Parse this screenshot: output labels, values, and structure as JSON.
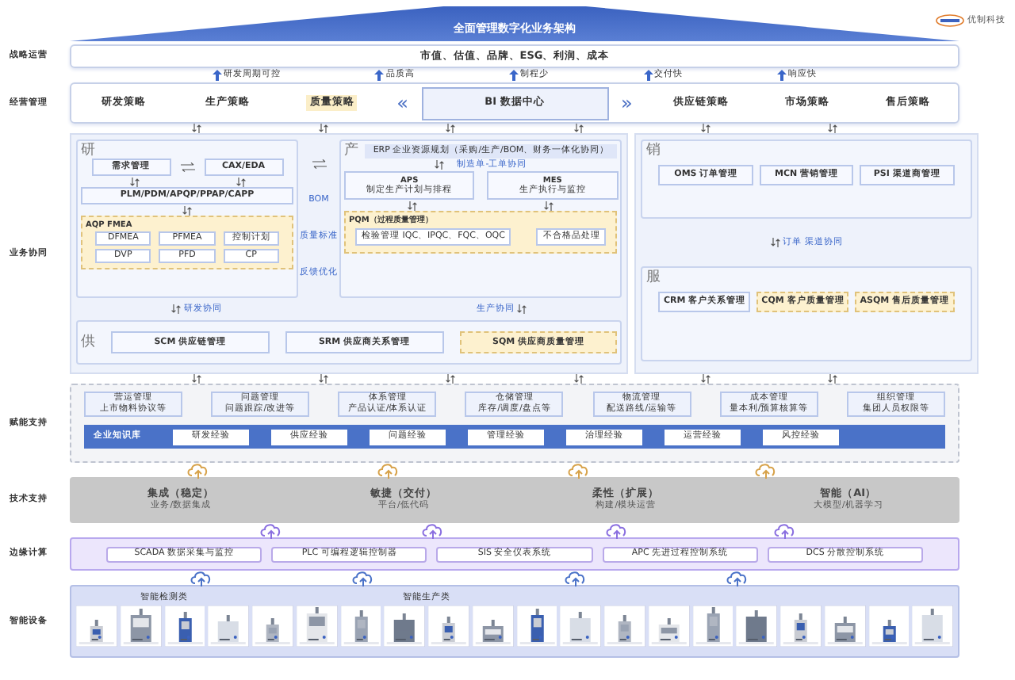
{
  "header": {
    "title": "全面管理数字化业务架构",
    "logo_text": "优制科技"
  },
  "strategy": {
    "label": "战略运营",
    "text": "市值、估值、品牌、ESG、利润、成本"
  },
  "targets": [
    "研发周期可控",
    "品质高",
    "制程少",
    "交付快",
    "响应快"
  ],
  "management": {
    "label": "经营管理",
    "left": [
      {
        "text": "研发策略",
        "highlighted": false
      },
      {
        "text": "生产策略",
        "highlighted": false
      },
      {
        "text": "质量策略",
        "highlighted": true
      }
    ],
    "prev": "«",
    "center": "BI 数据中心",
    "next": "»",
    "right": [
      {
        "text": "供应链策略",
        "highlighted": false
      },
      {
        "text": "市场策略",
        "highlighted": false
      },
      {
        "text": "售后策略",
        "highlighted": false
      }
    ]
  },
  "collaboration": {
    "label": "业务协同",
    "rd": {
      "title": "研",
      "modules": [
        "需求管理",
        "CAX/EDA"
      ],
      "plm": "PLM/PDM/APQP/PPAP/CAPP",
      "fmea": {
        "title": "AQP FMEA",
        "items": [
          "DFMEA",
          "PFMEA",
          "控制计划",
          "DVP",
          "PFD",
          "CP"
        ]
      }
    },
    "links": [
      "BOM",
      "质量标准",
      "反馈优化"
    ],
    "production": {
      "title": "产",
      "erp": "ERP 企业资源规划（采购/生产/BOM、财务一体化协同）",
      "order_link": "制造单-工单协同",
      "aps": {
        "name": "APS",
        "desc": "制定生产计划与排程"
      },
      "mes": {
        "name": "MES",
        "desc": "生产执行与监控"
      },
      "pqm": {
        "title": "PQM（过程质量管理）",
        "items": [
          "检验管理 IQC、IPQC、FQC、OQC",
          "不合格品处理"
        ]
      }
    },
    "flows": [
      "研发协同",
      "生产协同"
    ],
    "supply": {
      "title": "供",
      "modules": [
        {
          "text": "SCM 供应链管理",
          "highlighted": false
        },
        {
          "text": "SRM 供应商关系管理",
          "highlighted": false
        },
        {
          "text": "SQM 供应商质量管理",
          "highlighted": true
        }
      ]
    },
    "sales": {
      "title": "销",
      "modules": [
        {
          "text": "OMS 订单管理",
          "highlighted": false
        },
        {
          "text": "MCN 营销管理",
          "highlighted": false
        },
        {
          "text": "PSI 渠道商管理",
          "highlighted": false
        }
      ]
    },
    "sales_flow": "订单 渠道协同",
    "service": {
      "title": "服",
      "modules": [
        {
          "text": "CRM 客户关系管理",
          "highlighted": false
        },
        {
          "text": "CQM 客户质量管理",
          "highlighted": true
        },
        {
          "text": "ASQM 售后质量管理",
          "highlighted": true
        }
      ]
    }
  },
  "support": {
    "label": "赋能支持",
    "modules": [
      {
        "title": "营运管理",
        "desc": "上市物料协议等"
      },
      {
        "title": "问题管理",
        "desc": "问题跟踪/改进等"
      },
      {
        "title": "体系管理",
        "desc": "产品认证/体系认证"
      },
      {
        "title": "仓储管理",
        "desc": "库存/调度/盘点等"
      },
      {
        "title": "物流管理",
        "desc": "配送路线/运输等"
      },
      {
        "title": "成本管理",
        "desc": "量本利/预算核算等"
      },
      {
        "title": "组织管理",
        "desc": "集团人员权限等"
      }
    ],
    "knowledge": {
      "label": "企业知识库",
      "items": [
        "研发经验",
        "供应经验",
        "问题经验",
        "管理经验",
        "治理经验",
        "运营经验",
        "风控经验"
      ]
    }
  },
  "tech": {
    "label": "技术支持",
    "pillars": [
      {
        "title": "集成（稳定）",
        "desc": "业务/数据集成"
      },
      {
        "title": "敏捷（交付）",
        "desc": "平台/低代码"
      },
      {
        "title": "柔性（扩展）",
        "desc": "构建/模块运营"
      },
      {
        "title": "智能（AI）",
        "desc": "大模型/机器学习"
      }
    ]
  },
  "edge": {
    "label": "边缘计算",
    "systems": [
      "SCADA 数据采集与监控",
      "PLC 可编程逻辑控制器",
      "SIS 安全仪表系统",
      "APC 先进过程控制系统",
      "DCS 分散控制系统"
    ]
  },
  "devices": {
    "label": "智能设备",
    "groups": [
      "智能检测类",
      "智能生产类"
    ],
    "items": [
      {
        "kind": "picture"
      },
      {
        "kind": "picture"
      },
      {
        "kind": "picture"
      },
      {
        "kind": "picture"
      },
      {
        "kind": "picture"
      },
      {
        "kind": "picture"
      },
      {
        "kind": "picture"
      },
      {
        "kind": "picture"
      },
      {
        "kind": "picture"
      },
      {
        "kind": "picture"
      },
      {
        "kind": "picture"
      },
      {
        "kind": "picture"
      },
      {
        "kind": "picture"
      },
      {
        "kind": "picture"
      },
      {
        "kind": "picture"
      },
      {
        "kind": "picture"
      },
      {
        "kind": "picture"
      },
      {
        "kind": "picture"
      },
      {
        "kind": "picture"
      },
      {
        "kind": "picture"
      }
    ]
  }
}
